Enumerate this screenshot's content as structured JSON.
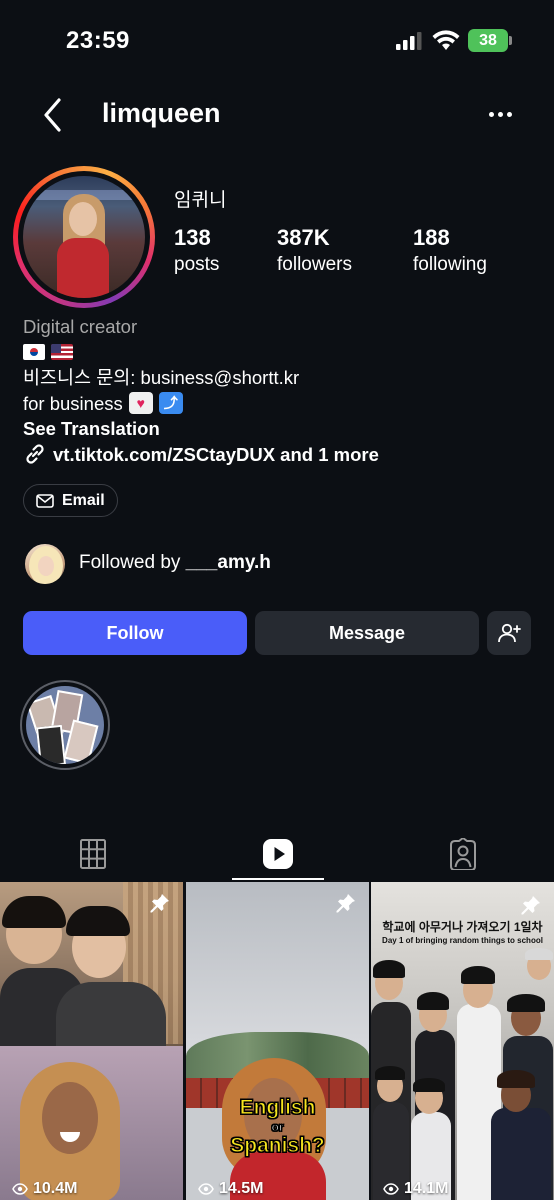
{
  "status_bar": {
    "time": "23:59",
    "battery": "38"
  },
  "header": {
    "username": "limqueen"
  },
  "profile": {
    "display_name": "임퀴니",
    "stats": [
      {
        "value": "138",
        "label": "posts"
      },
      {
        "value": "387K",
        "label": "followers"
      },
      {
        "value": "188",
        "label": "following"
      }
    ],
    "category": "Digital creator",
    "bio_business": "비즈니스 문의: business@shortt.kr",
    "bio_for_business": "for business",
    "see_translation": "See Translation",
    "link_text": "vt.tiktok.com/ZSCtayDUX and 1 more",
    "email_label": "Email"
  },
  "followed_by": {
    "prefix": "Followed by",
    "name": "___amy.h"
  },
  "actions": {
    "follow": "Follow",
    "message": "Message"
  },
  "reels": [
    {
      "views": "10.4M",
      "pinned": true
    },
    {
      "views": "14.5M",
      "pinned": true,
      "caption_line1": "English",
      "caption_line2": "or",
      "caption_line3": "Spanish?"
    },
    {
      "views": "14.1M",
      "pinned": true,
      "caption_title": "학교에 아무거나 가져오기 1일차",
      "caption_sub": "Day 1 of bringing random things to school"
    }
  ],
  "colors": {
    "follow_button": "#4a5df9",
    "background": "#0c0f14",
    "secondary_button": "#262a31",
    "battery": "#4fc25a"
  }
}
